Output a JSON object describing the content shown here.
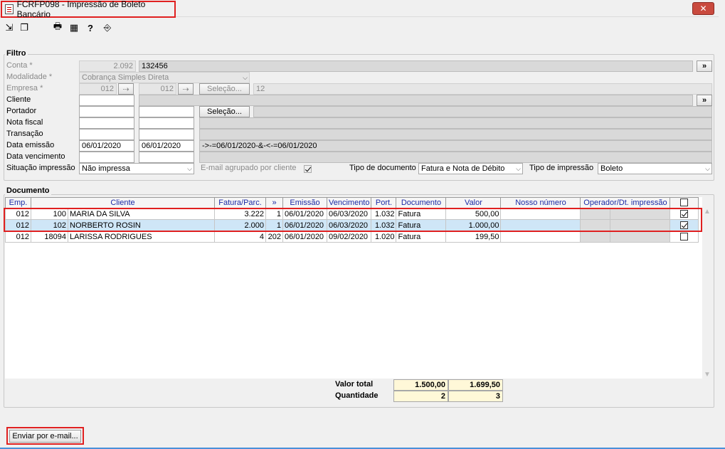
{
  "window": {
    "title": "FCRFP098 - Impressão de Boleto Bancário",
    "close": "✕"
  },
  "filtro": {
    "title": "Filtro",
    "conta": {
      "label": "Conta *",
      "code": "2.092",
      "desc": "132456"
    },
    "modalidade": {
      "label": "Modalidade *",
      "value": "Cobrança Simples Direta"
    },
    "empresa": {
      "label": "Empresa *",
      "from": "012",
      "to": "012",
      "selecao": "Seleção...",
      "count": "12"
    },
    "cliente": {
      "label": "Cliente"
    },
    "portador": {
      "label": "Portador",
      "selecao": "Seleção..."
    },
    "nota_fiscal": {
      "label": "Nota fiscal"
    },
    "transacao": {
      "label": "Transação"
    },
    "data_emissao": {
      "label": "Data emissão",
      "from": "06/01/2020",
      "to": "06/01/2020",
      "expr": "->-=06/01/2020-&-<-=06/01/2020"
    },
    "data_vencimento": {
      "label": "Data vencimento"
    },
    "situacao": {
      "label": "Situação impressão",
      "value": "Não impressa"
    },
    "email_agrupado": {
      "label": "E-mail agrupado por cliente",
      "checked": true
    },
    "tipo_documento": {
      "label": "Tipo de documento",
      "value": "Fatura e Nota de Débito"
    },
    "tipo_impressao": {
      "label": "Tipo de impressão",
      "value": "Boleto"
    },
    "more": "»"
  },
  "documento": {
    "title": "Documento",
    "columns": [
      "Emp.",
      "Cliente",
      "Fatura/Parc.",
      "»",
      "Emissão",
      "Vencimento",
      "Port.",
      "Documento",
      "Valor",
      "Nosso número",
      "Operador/Dt. impressão"
    ],
    "rows": [
      {
        "emp": "012",
        "code": "100",
        "cliente": "MARIA DA SILVA",
        "fatura": "3.222",
        "parc": "1",
        "emissao": "06/01/2020",
        "vencimento": "06/03/2020",
        "port": "1.032",
        "documento": "Fatura",
        "valor": "500,00",
        "checked": true
      },
      {
        "emp": "012",
        "code": "102",
        "cliente": "NORBERTO ROSIN",
        "fatura": "2.000",
        "parc": "1",
        "emissao": "06/01/2020",
        "vencimento": "06/03/2020",
        "port": "1.032",
        "documento": "Fatura",
        "valor": "1.000,00",
        "checked": true
      },
      {
        "emp": "012",
        "code": "18094",
        "cliente": "LARISSA RODRIGUES",
        "fatura": "4",
        "parc": "202",
        "emissao": "06/01/2020",
        "vencimento": "09/02/2020",
        "port": "1.020",
        "documento": "Fatura",
        "valor": "199,50",
        "checked": false
      }
    ],
    "totals": {
      "valor_total_label": "Valor total",
      "valor_selected": "1.500,00",
      "valor_all": "1.699,50",
      "quantidade_label": "Quantidade",
      "qtd_selected": "2",
      "qtd_all": "3"
    }
  },
  "footer": {
    "email_button": "Enviar por e-mail..."
  },
  "colors": {
    "accent_red": "#e02020",
    "header_text": "#1a2aa6",
    "selected_row": "#cfe6f7"
  }
}
